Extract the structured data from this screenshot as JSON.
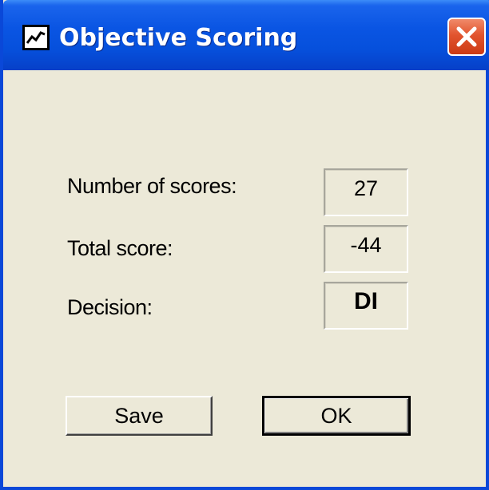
{
  "window": {
    "title": "Objective Scoring",
    "icon": "chart-line-icon",
    "close_icon": "close-x-icon"
  },
  "fields": [
    {
      "label": "Number of scores:",
      "value": "27"
    },
    {
      "label": "Total score:",
      "value": "-44"
    },
    {
      "label": "Decision:",
      "value": "DI"
    }
  ],
  "buttons": {
    "save_label": "Save",
    "ok_label": "OK"
  },
  "colors": {
    "titlebar": "#0a55e3",
    "dialog_bg": "#ece9d8",
    "close_button": "#e2542e"
  }
}
